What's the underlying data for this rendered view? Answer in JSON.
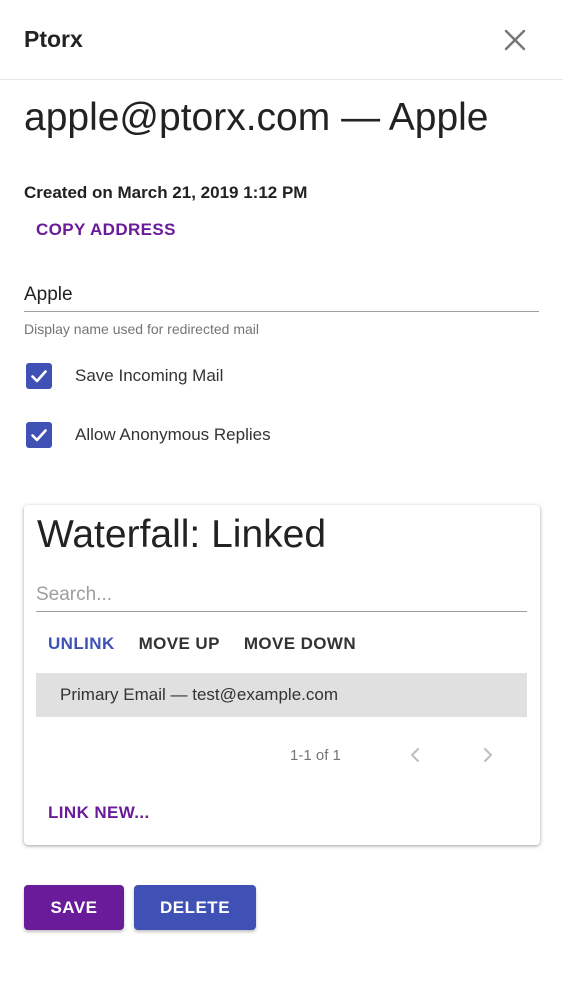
{
  "app": {
    "title": "Ptorx"
  },
  "alias": {
    "title": "apple@ptorx.com — Apple",
    "created": "Created on March 21, 2019 1:12 PM",
    "copy_label": "COPY ADDRESS"
  },
  "name_field": {
    "value": "Apple",
    "helper": "Display name used for redirected mail"
  },
  "options": [
    {
      "label": "Save Incoming Mail",
      "checked": true
    },
    {
      "label": "Allow Anonymous Replies",
      "checked": true
    }
  ],
  "waterfall": {
    "title": "Waterfall: Linked",
    "search_placeholder": "Search...",
    "actions": {
      "unlink": "UNLINK",
      "move_up": "MOVE UP",
      "move_down": "MOVE DOWN"
    },
    "rows": [
      {
        "label": "Primary Email — test@example.com"
      }
    ],
    "pagination": "1-1 of 1",
    "link_new": "LINK NEW..."
  },
  "buttons": {
    "save": "SAVE",
    "delete": "DELETE"
  },
  "colors": {
    "purple": "#6a1b9a",
    "indigo": "#3f51b5",
    "row_selected": "#e0e0e0"
  },
  "icons": {
    "close": "close-icon",
    "check": "check-icon",
    "prev": "chevron-left-icon",
    "next": "chevron-right-icon"
  }
}
